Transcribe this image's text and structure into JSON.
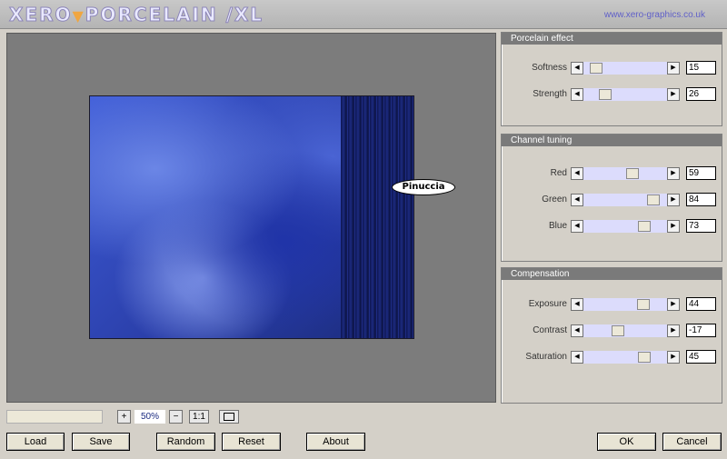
{
  "header": {
    "logo_part1": "XERO",
    "logo_part2": "PORCELAIN /XL",
    "website": "www.xero-graphics.co.uk"
  },
  "preview": {
    "watermark": "Pinuccia"
  },
  "panels": [
    {
      "title": "Porcelain effect",
      "controls": [
        {
          "label": "Softness",
          "value": "15",
          "level": 0.15
        },
        {
          "label": "Strength",
          "value": "26",
          "level": 0.26
        }
      ]
    },
    {
      "title": "Channel tuning",
      "controls": [
        {
          "label": "Red",
          "value": "59",
          "level": 0.59
        },
        {
          "label": "Green",
          "value": "84",
          "level": 0.84
        },
        {
          "label": "Blue",
          "value": "73",
          "level": 0.73
        }
      ]
    },
    {
      "title": "Compensation",
      "controls": [
        {
          "label": "Exposure",
          "value": "44",
          "level": 0.72
        },
        {
          "label": "Contrast",
          "value": "-17",
          "level": 0.41
        },
        {
          "label": "Saturation",
          "value": "45",
          "level": 0.725
        }
      ]
    }
  ],
  "zoom": {
    "plus": "+",
    "value": "50%",
    "minus": "−",
    "one_to_one": "1:1"
  },
  "buttons": {
    "load": "Load",
    "save": "Save",
    "random": "Random",
    "reset": "Reset",
    "about": "About",
    "ok": "OK",
    "cancel": "Cancel"
  },
  "colors": {
    "accent_text": "#6060c8",
    "panel_header": "#7a7a7a",
    "slider_track": "#dcdcfc"
  }
}
